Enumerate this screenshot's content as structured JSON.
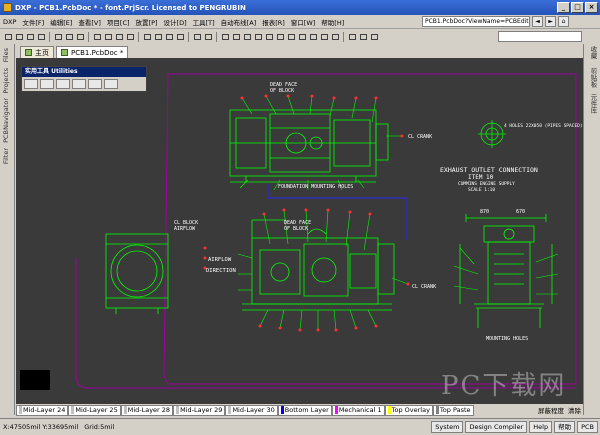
{
  "titlebar": {
    "caption": "DXP - PCB1.PcbDoc * - font.PrjScr. Licensed to PENGRUBIN",
    "buttons": [
      "_",
      "□",
      "×"
    ]
  },
  "menubar": {
    "items": [
      "DXP",
      "文件[F]",
      "编辑[E]",
      "查看[V]",
      "项目[C]",
      "放置[P]",
      "设计[D]",
      "工具[T]",
      "自动布线[A]",
      "报表[R]",
      "窗口[W]",
      "帮助[H]"
    ],
    "path": "PCB1.PcbDoc?ViewName=PCBEditor.."
  },
  "left_panel": {
    "tabs": [
      "Files",
      "Projects",
      "Navigator",
      "PCB",
      "Filter"
    ]
  },
  "right_panel": {
    "tabs": [
      "收藏",
      "剪贴板",
      "元件库"
    ]
  },
  "doc_tabs": [
    {
      "label": "主页",
      "active": false
    },
    {
      "label": "PCB1.PcbDoc *",
      "active": true
    }
  ],
  "utilities": {
    "title": "实用工具 Utilities"
  },
  "drawing": {
    "labels": {
      "dead_face_top_1": "DEAD FACE",
      "dead_face_top_2": "OF BLOCK",
      "cl_crank_top": "CL CRANK",
      "foundation": "FOUNDATION MOUNTING HOLES",
      "hole_note": "4 HOLES 22X050 (PIPES SPACED)",
      "exhaust_1": "EXHAUST OUTLET CONNECTION",
      "exhaust_2": "ITEM 10",
      "exhaust_3": "CUMMINS ENGINE SUPPLY",
      "exhaust_4": "SCALE 1:10",
      "dim_1": "870",
      "dim_2": "670",
      "cl_block_1": "CL BLOCK",
      "cl_block_2": "AIRFLOW",
      "airflow_1": "AIRFLOW",
      "airflow_2": "DIRECTION",
      "dead_face_side_1": "DEAD FACE",
      "dead_face_side_2": "OF BLOCK",
      "cl_crank_side": "CL CRANK",
      "mounting_holes": "MOUNTING HOLES"
    }
  },
  "layer_tabs": [
    {
      "label": "Mid-Layer 24",
      "color": "#c0c0c0"
    },
    {
      "label": "Mid-Layer 25",
      "color": "#c0c0c0"
    },
    {
      "label": "Mid-Layer 28",
      "color": "#c0c0c0"
    },
    {
      "label": "Mid-Layer 29",
      "color": "#c0c0c0"
    },
    {
      "label": "Mid-Layer 30",
      "color": "#c0c0c0"
    },
    {
      "label": "Bottom Layer",
      "color": "#0000ff"
    },
    {
      "label": "Mechanical 1",
      "color": "#ff00ff"
    },
    {
      "label": "Top Overlay",
      "color": "#ffff00"
    },
    {
      "label": "Top Paste",
      "color": "#808080"
    }
  ],
  "layer_controls": [
    "屏蔽程度",
    "清除"
  ],
  "status": {
    "coords": "X:47505mil Y:33695mil",
    "grid": "Grid:5mil",
    "buttons": [
      "System",
      "Design Compiler",
      "Help",
      "帮助",
      "PCB"
    ]
  },
  "watermark": "PC下载网",
  "colors": {
    "canvas": "#3a3a3a",
    "drawing_green": "#00ff00",
    "board_outline": "#a000a0",
    "route_blue": "#2a2acf",
    "text_white": "#ffffff",
    "leader_red": "#ff3030"
  }
}
